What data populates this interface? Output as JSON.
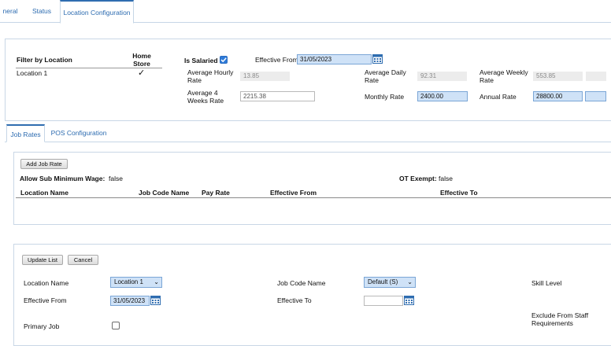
{
  "tabs": [
    "neral",
    "Status",
    "Location Configuration"
  ],
  "location_panel": {
    "filter_header": "Filter by Location",
    "home_store_header": "Home Store",
    "location_row": "Location 1",
    "home_store_mark": "✓"
  },
  "salary": {
    "is_salaried_label": "Is Salaried",
    "is_salaried_checked": true,
    "effective_from_label": "Effective From",
    "effective_from_value": "31/05/2023",
    "avg_hourly_label": "Average Hourly Rate",
    "avg_hourly_value": "13.85",
    "avg_daily_label": "Average Daily Rate",
    "avg_daily_value": "92.31",
    "avg_weekly_label": "Average Weekly Rate",
    "avg_weekly_value": "553.85",
    "avg_4weeks_label": "Average 4 Weeks Rate",
    "avg_4weeks_value": "2215.38",
    "monthly_label": "Monthly Rate",
    "monthly_value": "2400.00",
    "annual_label": "Annual Rate",
    "annual_value": "28800.00"
  },
  "subtabs": [
    "Job Rates",
    "POS Configuration"
  ],
  "job_rates": {
    "add_button": "Add Job Rate",
    "allow_sub_min_label": "Allow Sub Minimum Wage:",
    "allow_sub_min_value": "false",
    "ot_exempt_label": "OT Exempt:",
    "ot_exempt_value": "false",
    "columns": [
      "Location Name",
      "Job Code Name",
      "Pay Rate",
      "Effective From",
      "Effective To"
    ]
  },
  "edit_form": {
    "update_button": "Update List",
    "cancel_button": "Cancel",
    "location_name_label": "Location Name",
    "location_name_value": "Location 1",
    "job_code_label": "Job Code Name",
    "job_code_value": "Default (S)",
    "skill_level_label": "Skill Level",
    "effective_from_label": "Effective From",
    "effective_from_value": "31/05/2023",
    "effective_to_label": "Effective To",
    "effective_to_value": "",
    "primary_job_label": "Primary Job",
    "primary_job_checked": false,
    "exclude_staff_label": "Exclude From Staff Requirements"
  },
  "colors": {
    "tab_text": "#2c6bb0",
    "frame_border": "#c9d7e6",
    "highlight_input": "#cfe2f7",
    "checkbox_blue": "#2f7bd9"
  }
}
